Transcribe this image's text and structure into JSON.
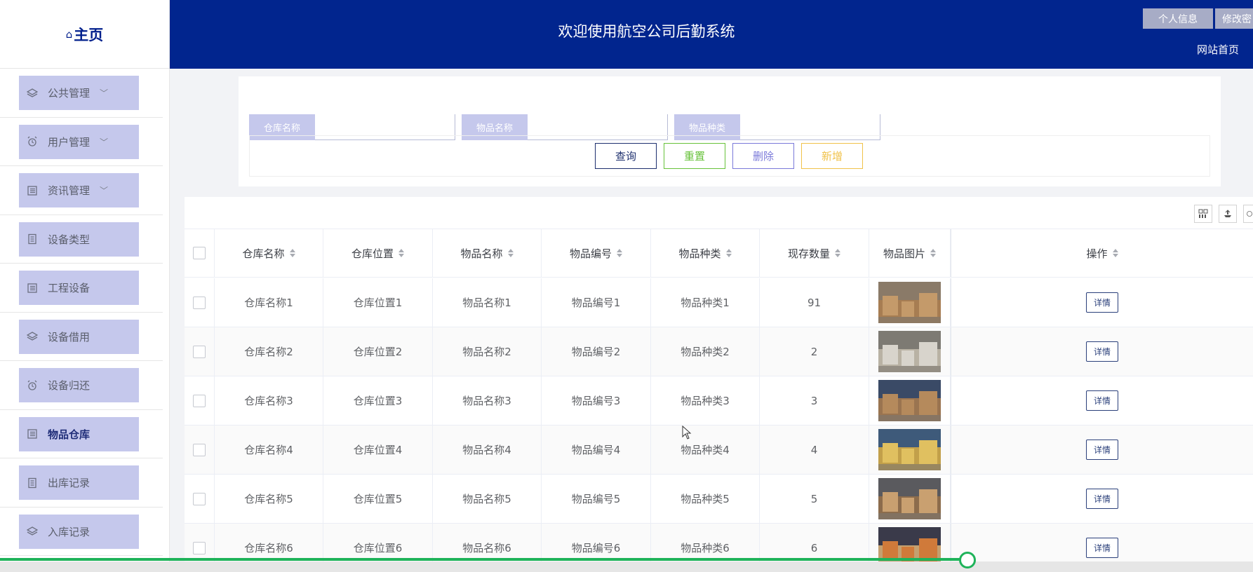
{
  "logo": {
    "icon": "home-icon",
    "label": "主页"
  },
  "sidebar": {
    "items": [
      {
        "label": "公共管理",
        "icon": "layers-icon",
        "expandable": true
      },
      {
        "label": "用户管理",
        "icon": "alarm-icon",
        "expandable": true
      },
      {
        "label": "资讯管理",
        "icon": "list-icon",
        "expandable": true
      },
      {
        "label": "设备类型",
        "icon": "document-icon",
        "expandable": false
      },
      {
        "label": "工程设备",
        "icon": "list-icon",
        "expandable": false
      },
      {
        "label": "设备借用",
        "icon": "layers-icon",
        "expandable": false
      },
      {
        "label": "设备归还",
        "icon": "alarm-icon",
        "expandable": false
      },
      {
        "label": "物品仓库",
        "icon": "list-icon",
        "expandable": false,
        "active": true
      },
      {
        "label": "出库记录",
        "icon": "document-icon",
        "expandable": false
      },
      {
        "label": "入库记录",
        "icon": "layers-icon",
        "expandable": false
      }
    ]
  },
  "header": {
    "title": "欢迎使用航空公司后勤系统",
    "profile_btn": "个人信息",
    "change_btn": "修改密",
    "home_link": "网站首页"
  },
  "search": {
    "fields": [
      {
        "label": "仓库名称",
        "value": ""
      },
      {
        "label": "物品名称",
        "value": ""
      },
      {
        "label": "物品种类",
        "value": ""
      }
    ],
    "buttons": {
      "query": "查询",
      "reset": "重置",
      "delete": "删除",
      "add": "新增"
    }
  },
  "table": {
    "columns": [
      "仓库名称",
      "仓库位置",
      "物品名称",
      "物品编号",
      "物品种类",
      "现存数量",
      "物品图片",
      "操作"
    ],
    "rows": [
      {
        "warehouse": "仓库名称1",
        "location": "仓库位置1",
        "name": "物品名称1",
        "code": "物品编号1",
        "category": "物品种类1",
        "qty": "91"
      },
      {
        "warehouse": "仓库名称2",
        "location": "仓库位置2",
        "name": "物品名称2",
        "code": "物品编号2",
        "category": "物品种类2",
        "qty": "2"
      },
      {
        "warehouse": "仓库名称3",
        "location": "仓库位置3",
        "name": "物品名称3",
        "code": "物品编号3",
        "category": "物品种类3",
        "qty": "3"
      },
      {
        "warehouse": "仓库名称4",
        "location": "仓库位置4",
        "name": "物品名称4",
        "code": "物品编号4",
        "category": "物品种类4",
        "qty": "4"
      },
      {
        "warehouse": "仓库名称5",
        "location": "仓库位置5",
        "name": "物品名称5",
        "code": "物品编号5",
        "category": "物品种类5",
        "qty": "5"
      },
      {
        "warehouse": "仓库名称6",
        "location": "仓库位置6",
        "name": "物品名称6",
        "code": "物品编号6",
        "category": "物品种类6",
        "qty": "6"
      }
    ],
    "detail_label": "详情"
  },
  "progress": {
    "fraction": 0.772
  },
  "colors": {
    "header": "#01258e",
    "menu": "#c5c8ec",
    "progress": "#1fb35a"
  }
}
